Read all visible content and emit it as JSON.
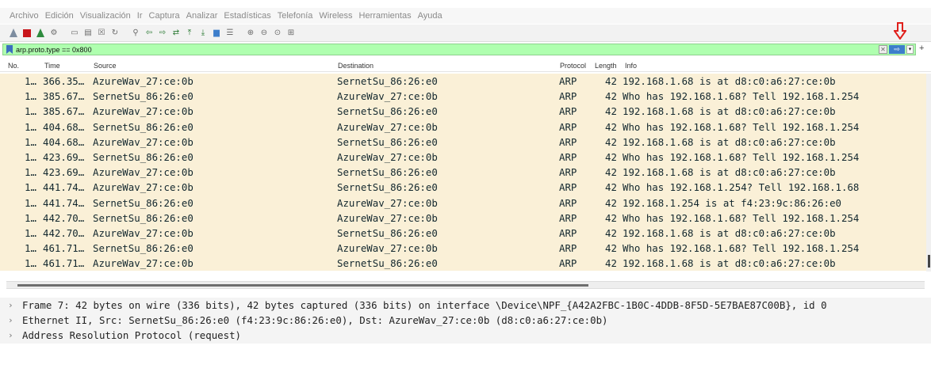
{
  "menu": [
    "Archivo",
    "Edición",
    "Visualización",
    "Ir",
    "Captura",
    "Analizar",
    "Estadísticas",
    "Telefonía",
    "Wireless",
    "Herramientas",
    "Ayuda"
  ],
  "filter": {
    "text": "arp.proto.type == 0x800",
    "add_label": "+"
  },
  "columns": {
    "no": "No.",
    "time": "Time",
    "source": "Source",
    "destination": "Destination",
    "protocol": "Protocol",
    "length": "Length",
    "info": "Info"
  },
  "packets": [
    {
      "no": "1…",
      "time": "366.35…",
      "source": "AzureWav_27:ce:0b",
      "destination": "SernetSu_86:26:e0",
      "protocol": "ARP",
      "length": "42",
      "info": "192.168.1.68 is at d8:c0:a6:27:ce:0b"
    },
    {
      "no": "1…",
      "time": "385.67…",
      "source": "SernetSu_86:26:e0",
      "destination": "AzureWav_27:ce:0b",
      "protocol": "ARP",
      "length": "42",
      "info": "Who has 192.168.1.68? Tell 192.168.1.254"
    },
    {
      "no": "1…",
      "time": "385.67…",
      "source": "AzureWav_27:ce:0b",
      "destination": "SernetSu_86:26:e0",
      "protocol": "ARP",
      "length": "42",
      "info": "192.168.1.68 is at d8:c0:a6:27:ce:0b"
    },
    {
      "no": "1…",
      "time": "404.68…",
      "source": "SernetSu_86:26:e0",
      "destination": "AzureWav_27:ce:0b",
      "protocol": "ARP",
      "length": "42",
      "info": "Who has 192.168.1.68? Tell 192.168.1.254"
    },
    {
      "no": "1…",
      "time": "404.68…",
      "source": "AzureWav_27:ce:0b",
      "destination": "SernetSu_86:26:e0",
      "protocol": "ARP",
      "length": "42",
      "info": "192.168.1.68 is at d8:c0:a6:27:ce:0b"
    },
    {
      "no": "1…",
      "time": "423.69…",
      "source": "SernetSu_86:26:e0",
      "destination": "AzureWav_27:ce:0b",
      "protocol": "ARP",
      "length": "42",
      "info": "Who has 192.168.1.68? Tell 192.168.1.254"
    },
    {
      "no": "1…",
      "time": "423.69…",
      "source": "AzureWav_27:ce:0b",
      "destination": "SernetSu_86:26:e0",
      "protocol": "ARP",
      "length": "42",
      "info": "192.168.1.68 is at d8:c0:a6:27:ce:0b"
    },
    {
      "no": "1…",
      "time": "441.74…",
      "source": "AzureWav_27:ce:0b",
      "destination": "SernetSu_86:26:e0",
      "protocol": "ARP",
      "length": "42",
      "info": "Who has 192.168.1.254? Tell 192.168.1.68"
    },
    {
      "no": "1…",
      "time": "441.74…",
      "source": "SernetSu_86:26:e0",
      "destination": "AzureWav_27:ce:0b",
      "protocol": "ARP",
      "length": "42",
      "info": "192.168.1.254 is at f4:23:9c:86:26:e0"
    },
    {
      "no": "1…",
      "time": "442.70…",
      "source": "SernetSu_86:26:e0",
      "destination": "AzureWav_27:ce:0b",
      "protocol": "ARP",
      "length": "42",
      "info": "Who has 192.168.1.68? Tell 192.168.1.254"
    },
    {
      "no": "1…",
      "time": "442.70…",
      "source": "AzureWav_27:ce:0b",
      "destination": "SernetSu_86:26:e0",
      "protocol": "ARP",
      "length": "42",
      "info": "192.168.1.68 is at d8:c0:a6:27:ce:0b"
    },
    {
      "no": "1…",
      "time": "461.71…",
      "source": "SernetSu_86:26:e0",
      "destination": "AzureWav_27:ce:0b",
      "protocol": "ARP",
      "length": "42",
      "info": "Who has 192.168.1.68? Tell 192.168.1.254"
    },
    {
      "no": "1…",
      "time": "461.71…",
      "source": "AzureWav_27:ce:0b",
      "destination": "SernetSu_86:26:e0",
      "protocol": "ARP",
      "length": "42",
      "info": "192.168.1.68 is at d8:c0:a6:27:ce:0b"
    }
  ],
  "details": [
    "Frame 7: 42 bytes on wire (336 bits), 42 bytes captured (336 bits) on interface \\Device\\NPF_{A42A2FBC-1B0C-4DDB-8F5D-5E7BAE87C00B}, id 0",
    "Ethernet II, Src: SernetSu_86:26:e0 (f4:23:9c:86:26:e0), Dst: AzureWav_27:ce:0b (d8:c0:a6:27:ce:0b)",
    "Address Resolution Protocol (request)"
  ],
  "colors": {
    "row_bg": "#faf0d7",
    "filter_valid_bg": "#afffaf",
    "annotation_arrow": "#e0201c"
  }
}
